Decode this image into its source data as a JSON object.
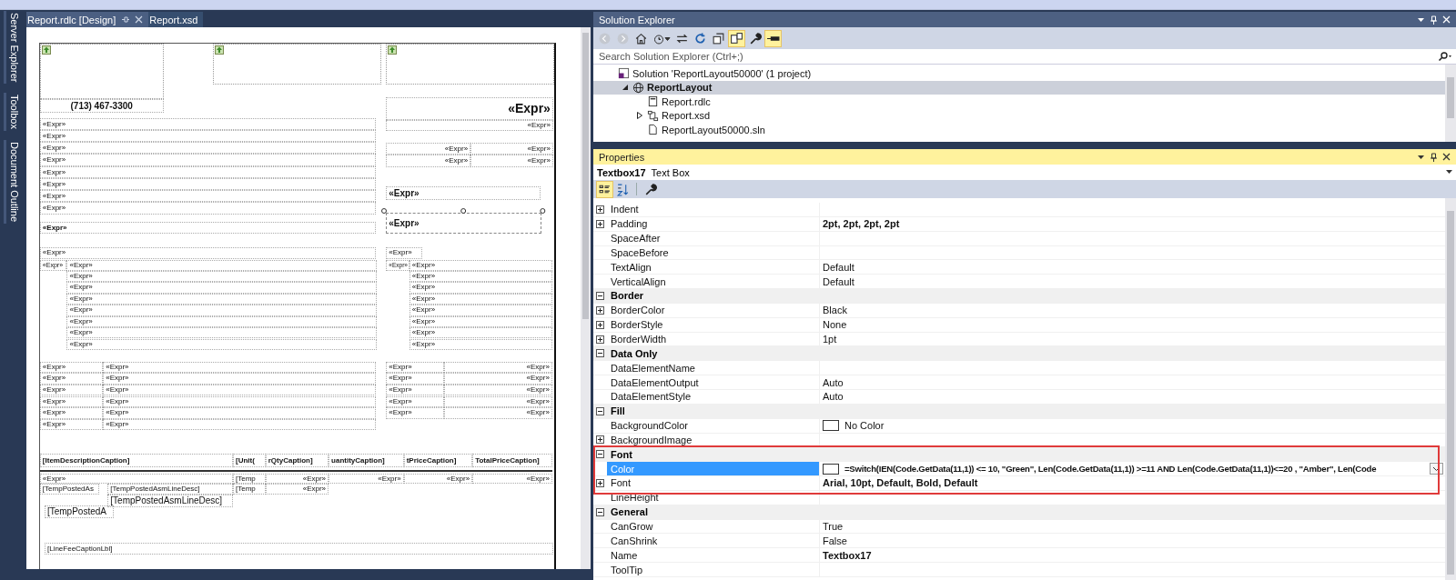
{
  "side_tabs": [
    "Server Explorer",
    "Toolbox",
    "Document Outline"
  ],
  "document_tabs": [
    {
      "label": "Report.rdlc [Design]",
      "selected": true
    },
    {
      "label": "Report.xsd",
      "selected": false
    }
  ],
  "report_items": [
    {
      "text": "(713) 467-3300",
      "selected": false
    },
    {
      "text": "«Expr»",
      "selected": false
    },
    {
      "text": "«Expr»",
      "selected": false
    },
    {
      "text": "«Expr»",
      "selected": false
    },
    {
      "text": "«Expr»",
      "selected": false
    },
    {
      "text": "«Expr»",
      "selected": false
    },
    {
      "text": "«Expr»",
      "selected": false
    },
    {
      "text": "«Expr»",
      "selected": false
    },
    {
      "text": "«Expr»",
      "selected": false
    },
    {
      "text": "«Expr»",
      "selected": false
    },
    {
      "text": "«Expr»",
      "selected": false
    },
    {
      "text": "«Expr»",
      "selected": false
    },
    {
      "text": "«Expr»",
      "selected": false
    },
    {
      "text": "«Expr»",
      "selected": false
    },
    {
      "text": "«Expr»",
      "selected": false
    },
    {
      "text": "«Expr»",
      "selected": false
    },
    {
      "text": "«Expr»",
      "selected": true
    },
    {
      "text": "«Expr»",
      "selected": false
    },
    {
      "text": "«Expr»",
      "selected": false
    },
    {
      "text": "«Expr»",
      "selected": false
    },
    {
      "text": "«Expr»",
      "selected": false
    },
    {
      "text": "«Expr»",
      "selected": false
    },
    {
      "text": "«Expr»",
      "selected": false
    },
    {
      "text": "«Expr»",
      "selected": false
    },
    {
      "text": "«Expr»",
      "selected": false
    },
    {
      "text": "«Expr»",
      "selected": false
    },
    {
      "text": "«Expr»",
      "selected": false
    },
    {
      "text": "«Expr»",
      "selected": false
    },
    {
      "text": "«Expr»",
      "selected": false
    },
    {
      "text": "«Expr»",
      "selected": false
    },
    {
      "text": "«Expr»",
      "selected": false
    },
    {
      "text": "«Expr»",
      "selected": false
    },
    {
      "text": "«Expr»",
      "selected": false
    },
    {
      "text": "«Expr»",
      "selected": false
    },
    {
      "text": "«Expr»",
      "selected": false
    },
    {
      "text": "«Expr»",
      "selected": false
    },
    {
      "text": "«Expr»",
      "selected": false
    },
    {
      "text": "«Expr»",
      "selected": false
    },
    {
      "text": "«Expr»",
      "selected": false
    },
    {
      "text": "«Expr»",
      "selected": false
    },
    {
      "text": "«Expr»",
      "selected": false
    },
    {
      "text": "«Expr»",
      "selected": false
    },
    {
      "text": "«Expr»",
      "selected": false
    },
    {
      "text": "«Expr»",
      "selected": false
    },
    {
      "text": "«Expr»",
      "selected": false
    },
    {
      "text": "«Expr»",
      "selected": false
    },
    {
      "text": "«Expr»",
      "selected": false
    },
    {
      "text": "«Expr»",
      "selected": false
    },
    {
      "text": "«Expr»",
      "selected": false
    },
    {
      "text": "«Expr»",
      "selected": false
    },
    {
      "text": "«Expr»",
      "selected": false
    },
    {
      "text": "«Expr»",
      "selected": false
    },
    {
      "text": "«Expr»",
      "selected": false
    },
    {
      "text": "«Expr»",
      "selected": false
    },
    {
      "text": "«Expr»",
      "selected": false
    },
    {
      "text": "«Expr»",
      "selected": false
    },
    {
      "text": "«Expr»",
      "selected": false
    },
    {
      "text": "«Expr»",
      "selected": false
    },
    {
      "text": "«Expr»",
      "selected": false
    },
    {
      "text": "«Expr»",
      "selected": false
    },
    {
      "text": "[ItemDescriptionCaption]",
      "selected": false
    },
    {
      "text": "[Unit(",
      "selected": false
    },
    {
      "text": "rQtyCaption]",
      "selected": false
    },
    {
      "text": "uantityCaption]",
      "selected": false
    },
    {
      "text": "tPriceCaption]",
      "selected": false
    },
    {
      "text": "TotalPriceCaption]",
      "selected": false
    },
    {
      "text": "«Expr»",
      "selected": false
    },
    {
      "text": "[Temp",
      "selected": false
    },
    {
      "text": "«Expr»",
      "selected": false
    },
    {
      "text": "«Expr»",
      "selected": false
    },
    {
      "text": "«Expr»",
      "selected": false
    },
    {
      "text": "«Expr»",
      "selected": false
    },
    {
      "text": "[TempPostedAs",
      "selected": false
    },
    {
      "text": "[TempPostedAsmLineDesc]",
      "selected": false
    },
    {
      "text": "[Temp",
      "selected": false
    },
    {
      "text": "«Expr»",
      "selected": false
    },
    {
      "text": "[TempPostedAsmLineDesc]",
      "selected": false
    },
    {
      "text": "[TempPostedA",
      "selected": false
    },
    {
      "text": "[LineFeeCaptionLbl]",
      "selected": false
    }
  ],
  "solution_explorer": {
    "title": "Solution Explorer",
    "search": {
      "placeholder": "Search Solution Explorer (Ctrl+;)"
    },
    "tree": [
      {
        "label": "Solution 'ReportLayout50000' (1 project)",
        "kind": "solution",
        "selected": false,
        "children": [
          {
            "label": "ReportLayout",
            "kind": "project",
            "selected": true,
            "expanded": true,
            "children": [
              {
                "label": "Report.rdlc",
                "kind": "report",
                "selected": false
              },
              {
                "label": "Report.xsd",
                "kind": "dataset",
                "selected": false,
                "expanded": false
              },
              {
                "label": "ReportLayout50000.sln",
                "kind": "file",
                "selected": false
              }
            ]
          }
        ]
      }
    ]
  },
  "properties": {
    "title": "Properties",
    "object_name": "Textbox17",
    "object_type": "Text Box",
    "rows": [
      {
        "kind": "property",
        "name": "Indent",
        "expandable": true,
        "selected": false
      },
      {
        "kind": "property",
        "name": "Padding",
        "value": "2pt, 2pt, 2pt, 2pt",
        "expandable": true,
        "modified": true,
        "selected": false
      },
      {
        "kind": "property",
        "name": "SpaceAfter",
        "expandable": false,
        "selected": false
      },
      {
        "kind": "property",
        "name": "SpaceBefore",
        "expandable": false,
        "selected": false
      },
      {
        "kind": "property",
        "name": "TextAlign",
        "value": "Default",
        "expandable": false,
        "modified": false,
        "selected": false
      },
      {
        "kind": "property",
        "name": "VerticalAlign",
        "value": "Default",
        "expandable": false,
        "modified": false,
        "selected": false
      },
      {
        "kind": "category",
        "name": "Border",
        "expanded": true
      },
      {
        "kind": "property",
        "name": "BorderColor",
        "value": "Black",
        "expandable": true,
        "modified": false,
        "selected": false
      },
      {
        "kind": "property",
        "name": "BorderStyle",
        "value": "None",
        "expandable": true,
        "modified": false,
        "selected": false
      },
      {
        "kind": "property",
        "name": "BorderWidth",
        "value": "1pt",
        "expandable": true,
        "modified": false,
        "selected": false
      },
      {
        "kind": "category",
        "name": "Data Only",
        "expanded": true
      },
      {
        "kind": "property",
        "name": "DataElementName",
        "expandable": false,
        "selected": false
      },
      {
        "kind": "property",
        "name": "DataElementOutput",
        "value": "Auto",
        "expandable": false,
        "modified": false,
        "selected": false
      },
      {
        "kind": "property",
        "name": "DataElementStyle",
        "value": "Auto",
        "expandable": false,
        "modified": false,
        "selected": false
      },
      {
        "kind": "category",
        "name": "Fill",
        "expanded": true
      },
      {
        "kind": "color",
        "name": "BackgroundColor",
        "value": "No Color",
        "expandable": false,
        "modified": false,
        "selected": false
      },
      {
        "kind": "property",
        "name": "BackgroundImage",
        "expandable": true,
        "selected": false
      },
      {
        "kind": "category",
        "name": "Font",
        "expanded": true
      },
      {
        "kind": "color",
        "name": "Color",
        "value": "=Switch(IEN(Code.GetData(11,1)) <= 10, \"Green\", Len(Code.GetData(11,1)) >=11 AND Len(Code.GetData(11,1))<=20 , \"Amber\", Len(Code",
        "expandable": false,
        "modified": true,
        "selected": true
      },
      {
        "kind": "property",
        "name": "Font",
        "value": "Arial, 10pt, Default, Bold, Default",
        "expandable": true,
        "modified": true,
        "selected": false
      },
      {
        "kind": "property",
        "name": "LineHeight",
        "expandable": false,
        "selected": false
      },
      {
        "kind": "category",
        "name": "General",
        "expanded": true
      },
      {
        "kind": "property",
        "name": "CanGrow",
        "value": "True",
        "expandable": false,
        "modified": false,
        "selected": false
      },
      {
        "kind": "property",
        "name": "CanShrink",
        "value": "False",
        "expandable": false,
        "modified": false,
        "selected": false
      },
      {
        "kind": "property",
        "name": "Name",
        "value": "Textbox17",
        "expandable": false,
        "modified": true,
        "selected": false
      },
      {
        "kind": "property",
        "name": "ToolTip",
        "expandable": false,
        "selected": false
      }
    ]
  }
}
